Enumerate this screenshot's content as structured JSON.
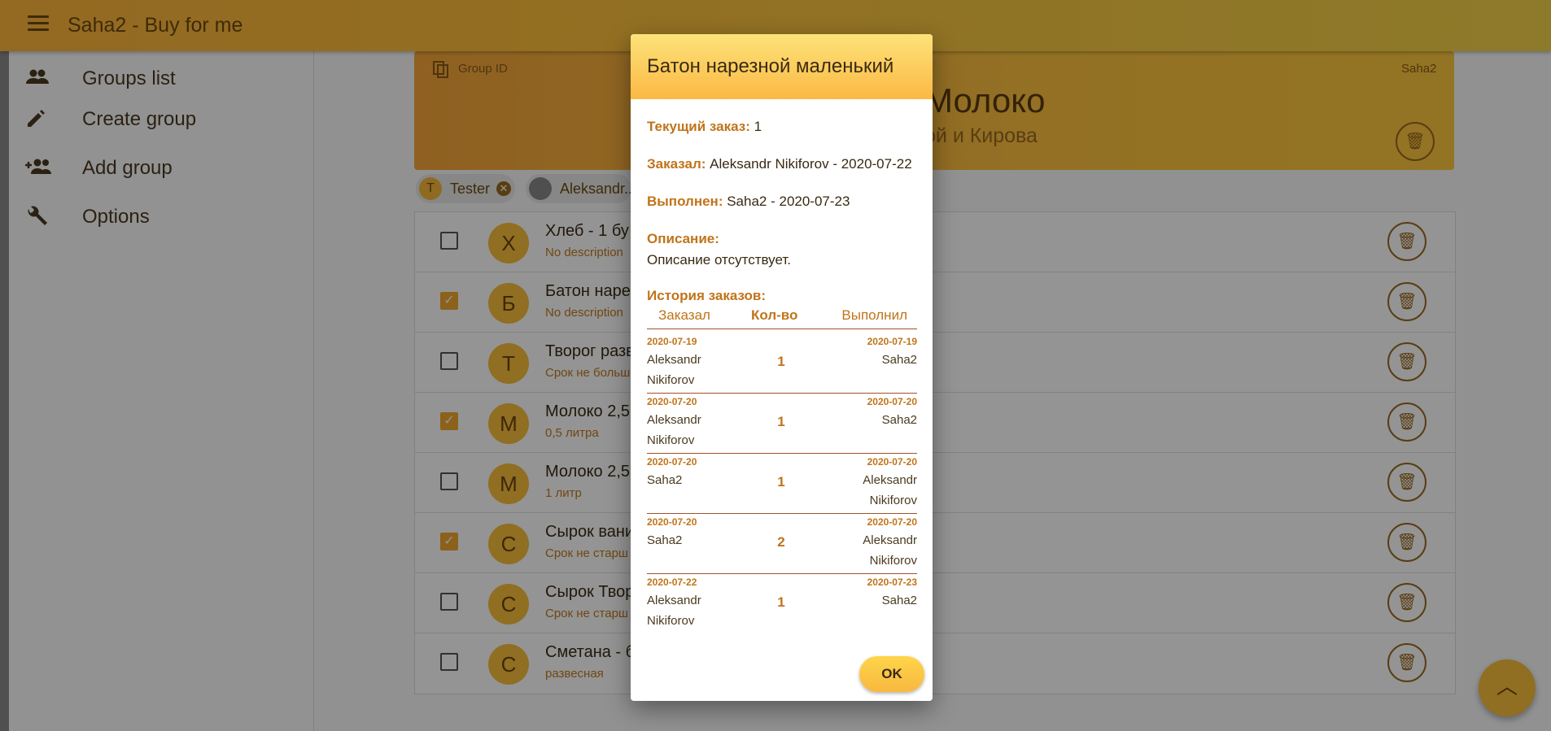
{
  "app": {
    "title": "Saha2 - Buy for me"
  },
  "sidebar": {
    "items": [
      {
        "label": "Groups list",
        "icon": "people-icon"
      },
      {
        "label": "Create group",
        "icon": "pencil-icon"
      },
      {
        "label": "Add group",
        "icon": "add-person-icon"
      },
      {
        "label": "Options",
        "icon": "wrench-icon"
      }
    ]
  },
  "group": {
    "id_label": "Group ID",
    "owner": "Saha2",
    "name": "Молоко",
    "subtitle": "ой и Кирова"
  },
  "chips": [
    {
      "avatar": "T",
      "label": "Tester"
    },
    {
      "avatar": "",
      "label": "Aleksandr..."
    }
  ],
  "items": [
    {
      "avatar": "Х",
      "title": "Хлеб - 1 бу",
      "subtitle": "No description",
      "checked": false
    },
    {
      "avatar": "Б",
      "title": "Батон наре",
      "subtitle": "No description",
      "checked": true
    },
    {
      "avatar": "Т",
      "title": "Творог разв",
      "subtitle": "Срок не больш",
      "checked": false
    },
    {
      "avatar": "М",
      "title": "Молоко 2,5",
      "subtitle": "0,5 литра",
      "checked": true
    },
    {
      "avatar": "М",
      "title": "Молоко 2,5",
      "subtitle": "1 литр",
      "checked": false
    },
    {
      "avatar": "С",
      "title": "Сырок вани",
      "subtitle": "Срок не старш",
      "checked": true
    },
    {
      "avatar": "С",
      "title": "Сырок Твор",
      "subtitle": "Срок не старш",
      "checked": false
    },
    {
      "avatar": "С",
      "title": "Сметана - б",
      "subtitle": "развесная",
      "checked": false
    }
  ],
  "dialog": {
    "title": "Батон нарезной маленький",
    "current_label": "Текущий заказ:",
    "current_value": "1",
    "ordered_label": "Заказал:",
    "ordered_value": "Aleksandr Nikiforov - 2020-07-22",
    "done_label": "Выполнен:",
    "done_value": "Saha2 - 2020-07-23",
    "desc_label": "Описание:",
    "desc_value": "Описание отсутствует.",
    "history_label": "История заказов:",
    "history_headers": {
      "ordered": "Заказал",
      "qty": "Кол-во",
      "done": "Выполнил"
    },
    "history": [
      {
        "ordered_date": "2020-07-19",
        "ordered_by": "Aleksandr Nikiforov",
        "qty": "1",
        "done_date": "2020-07-19",
        "done_by": "Saha2"
      },
      {
        "ordered_date": "2020-07-20",
        "ordered_by": "Aleksandr Nikiforov",
        "qty": "1",
        "done_date": "2020-07-20",
        "done_by": "Saha2"
      },
      {
        "ordered_date": "2020-07-20",
        "ordered_by": "Saha2",
        "qty": "1",
        "done_date": "2020-07-20",
        "done_by": "Aleksandr Nikiforov"
      },
      {
        "ordered_date": "2020-07-20",
        "ordered_by": "Saha2",
        "qty": "2",
        "done_date": "2020-07-20",
        "done_by": "Aleksandr Nikiforov"
      },
      {
        "ordered_date": "2020-07-22",
        "ordered_by": "Aleksandr Nikiforov",
        "qty": "1",
        "done_date": "2020-07-23",
        "done_by": "Saha2"
      }
    ],
    "ok_label": "OK"
  },
  "colors": {
    "accent": "#fbb944",
    "text_accent": "#c0741a"
  }
}
